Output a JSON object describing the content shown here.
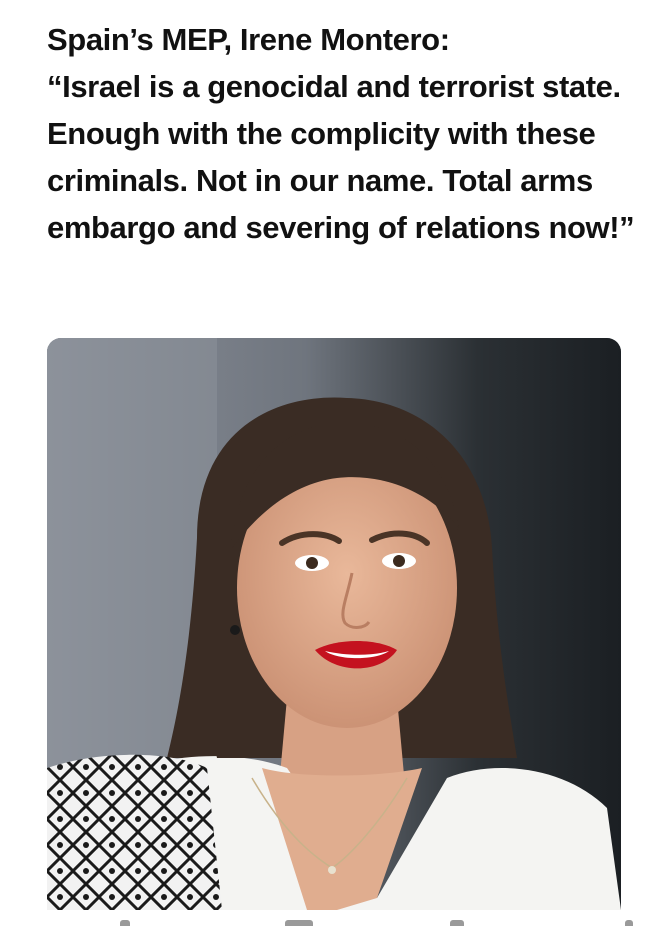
{
  "post": {
    "text": "Spain’s MEP, Irene Montero:\n“Israel is a genocidal and terrorist state. Enough with the complicity with these criminals. Not in our name. Total arms embargo and severing of relations now!”"
  },
  "media": {
    "icon": "photo-of-woman"
  },
  "bottom_bar": {
    "icons": [
      "reply-icon",
      "repost-icon",
      "like-icon",
      "views-icon",
      "share-icon"
    ]
  },
  "colors": {
    "text": "#111111",
    "background": "#ffffff"
  }
}
